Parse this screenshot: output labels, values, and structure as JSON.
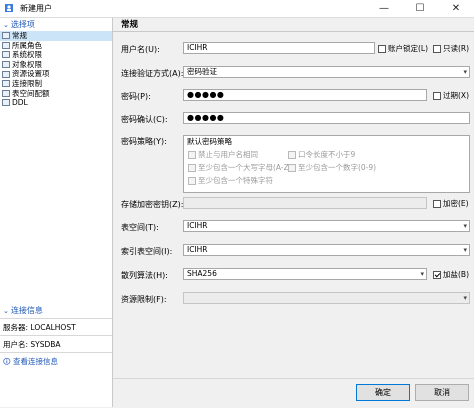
{
  "window": {
    "title": "新建用户",
    "min_glyph": "—",
    "max_glyph": "☐",
    "close_glyph": "✕"
  },
  "sidebar": {
    "section_title": "选择项",
    "items": [
      {
        "label": "常规",
        "selected": true
      },
      {
        "label": "所属角色"
      },
      {
        "label": "系统权限"
      },
      {
        "label": "对象权限"
      },
      {
        "label": "资源设置项"
      },
      {
        "label": "连接限制"
      },
      {
        "label": "表空间配额"
      },
      {
        "label": "DDL"
      }
    ],
    "conn_title": "连接信息",
    "server": "服务器: LOCALHOST",
    "user": "用户名: SYSDBA",
    "view_conn": "查看连接信息"
  },
  "main": {
    "tab_title": "常规",
    "username_label": "用户名(U):",
    "username_value": "ICIHR",
    "lock_label": "账户锁定(L)",
    "lock_checked": false,
    "readonly_label": "只读(R)",
    "readonly_checked": false,
    "auth_label": "连接验证方式(A):",
    "auth_value": "密码验证",
    "pwd_label": "密码(P):",
    "pwd_value": "●●●●●",
    "expire_label": "过期(X)",
    "expire_checked": false,
    "pwd_confirm_label": "密码确认(C):",
    "pwd_confirm_value": "●●●●●",
    "policy_label": "密码策略(Y):",
    "policy_value": "默认密码策略",
    "policy_options": [
      "禁止与用户名相同",
      "口令长度不小于9",
      "至少包含一个大写字母(A-Z)",
      "至少包含一个数字(0-9)",
      "至少包含一个特殊字符"
    ],
    "enc_pwd_label": "存储加密密钥(Z):",
    "encrypt_label": "加密(E)",
    "encrypt_checked": false,
    "tablespace_label": "表空间(T):",
    "tablespace_value": "ICIHR",
    "index_ts_label": "索引表空间(I):",
    "index_ts_value": "ICIHR",
    "hash_label": "散列算法(H):",
    "hash_value": "SHA256",
    "salt_label": "加盐(B)",
    "salt_checked": true,
    "resource_label": "资源限制(F):",
    "resource_value": ""
  },
  "footer": {
    "ok": "确定",
    "cancel": "取消"
  },
  "icons": {
    "dropdown": "▾",
    "chevron": "⌄",
    "info": "🛈"
  }
}
